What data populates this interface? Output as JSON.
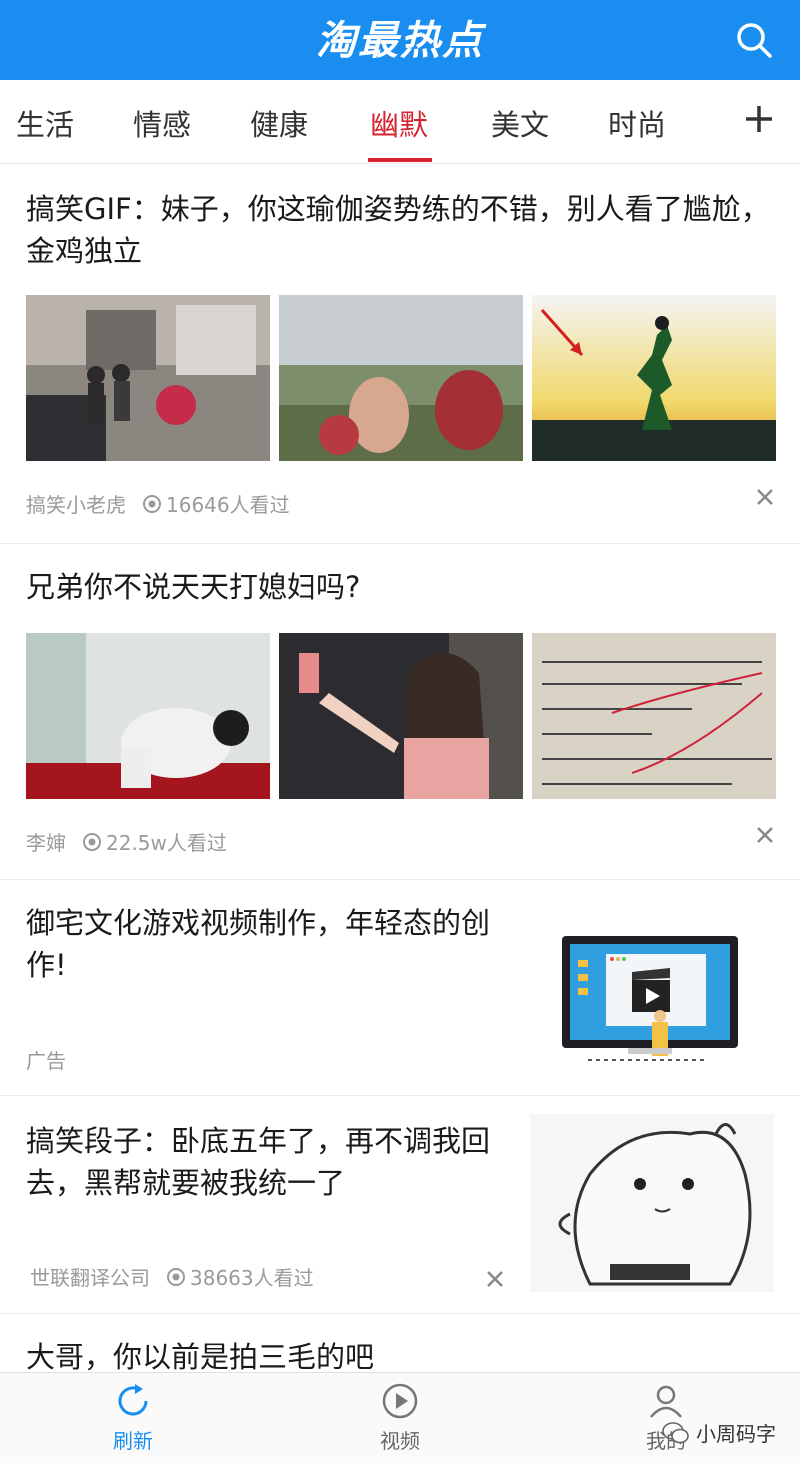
{
  "header": {
    "logo": "淘最热点",
    "search_icon": "search-icon"
  },
  "tabs": [
    {
      "label": "生活",
      "active": false
    },
    {
      "label": "情感",
      "active": false
    },
    {
      "label": "健康",
      "active": false
    },
    {
      "label": "幽默",
      "active": true
    },
    {
      "label": "美文",
      "active": false
    },
    {
      "label": "时尚",
      "active": false
    }
  ],
  "feed": [
    {
      "title": "搞笑GIF：妹子，你这瑜伽姿势练的不错，别人看了尴尬，金鸡独立",
      "source": "搞笑小老虎",
      "views": "16646人看过"
    },
    {
      "title": "兄弟你不说天天打媳妇吗?",
      "source": "李婶",
      "views": "22.5w人看过"
    },
    {
      "title": "御宅文化游戏视频制作，年轻态的创作!",
      "source": "广告"
    },
    {
      "title": "搞笑段子：卧底五年了，再不调我回去，黑帮就要被我统一了",
      "source": "世联翻译公司",
      "views": "38663人看过"
    },
    {
      "title": "大哥，你以前是拍三毛的吧"
    }
  ],
  "nav": [
    {
      "label": "刷新",
      "icon": "refresh-icon",
      "active": true
    },
    {
      "label": "视频",
      "icon": "play-icon",
      "active": false
    },
    {
      "label": "我的",
      "icon": "user-icon",
      "active": false
    }
  ],
  "watermark": "小周码字",
  "colors": {
    "brand_blue": "#1a8ef0",
    "active_red": "#d5232f"
  }
}
